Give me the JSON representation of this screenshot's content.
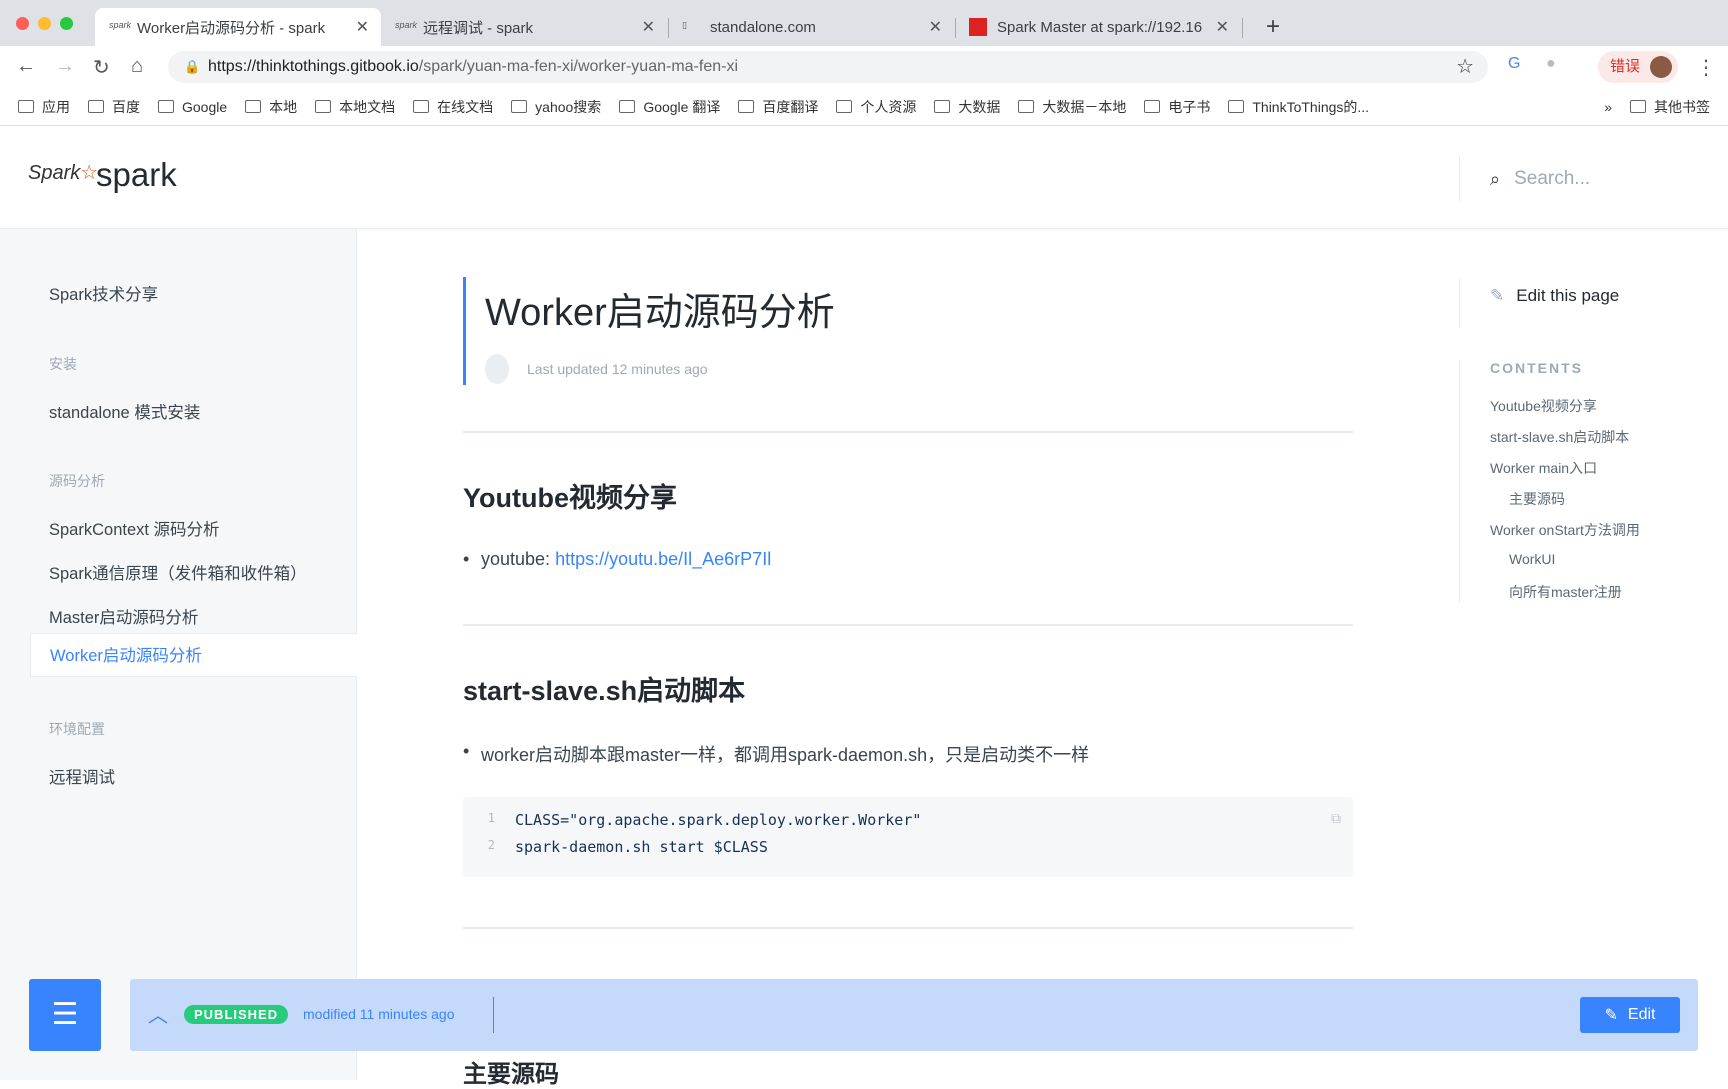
{
  "browser": {
    "tabs": [
      {
        "title": "Worker启动源码分析 - spark",
        "active": true
      },
      {
        "title": "远程调试 - spark"
      },
      {
        "title": "standalone.com"
      },
      {
        "title": "Spark Master at spark://192.16"
      }
    ],
    "url_domain": "https://thinktothings.gitbook.io",
    "url_path": "/spark/yuan-ma-fen-xi/worker-yuan-ma-fen-xi",
    "profile_status": "错误",
    "bookmarks": [
      "应用",
      "百度",
      "Google",
      "本地",
      "本地文档",
      "在线文档",
      "yahoo搜索",
      "Google 翻译",
      "百度翻译",
      "个人资源",
      "大数据",
      "大数据－本地",
      "电子书",
      "ThinkToThings的..."
    ],
    "other_bookmarks": "其他书签"
  },
  "header": {
    "brand": "spark",
    "logo_text": "Spark",
    "search_placeholder": "Search..."
  },
  "sidebar": {
    "items": [
      {
        "label": "Spark技术分享",
        "type": "item"
      },
      {
        "label": "安装",
        "type": "group"
      },
      {
        "label": "standalone 模式安装",
        "type": "item"
      },
      {
        "label": "源码分析",
        "type": "group"
      },
      {
        "label": "SparkContext 源码分析",
        "type": "item"
      },
      {
        "label": "Spark通信原理（发件箱和收件箱）",
        "type": "item"
      },
      {
        "label": "Master启动源码分析",
        "type": "item"
      },
      {
        "label": "Worker启动源码分析",
        "type": "item",
        "active": true
      },
      {
        "label": "环境配置",
        "type": "group"
      },
      {
        "label": "远程调试",
        "type": "item"
      }
    ]
  },
  "page": {
    "title": "Worker启动源码分析",
    "last_updated": "Last updated 12 minutes ago",
    "sections": [
      {
        "heading": "Youtube视频分享",
        "bullet_prefix": "youtube: ",
        "link": "https://youtu.be/Il_Ae6rP7Il"
      },
      {
        "heading": "start-slave.sh启动脚本",
        "bullet": "worker启动脚本跟master一样，都调用spark-daemon.sh，只是启动类不一样"
      }
    ],
    "code": [
      {
        "n": "1",
        "line": "CLASS=\"org.apache.spark.deploy.worker.Worker\""
      },
      {
        "n": "2",
        "line": "spark-daemon.sh start $CLASS"
      }
    ],
    "next_heading": "主要源码"
  },
  "toc": {
    "edit_label": "Edit this page",
    "heading": "CONTENTS",
    "items": [
      {
        "label": "Youtube视频分享"
      },
      {
        "label": "start-slave.sh启动脚本"
      },
      {
        "label": "Worker main入口"
      },
      {
        "label": "主要源码",
        "sub": true
      },
      {
        "label": "Worker onStart方法调用"
      },
      {
        "label": "WorkUI",
        "sub": true
      },
      {
        "label": "向所有master注册",
        "sub": true
      }
    ]
  },
  "bottom_bar": {
    "status": "PUBLISHED",
    "modified": "modified 11 minutes ago",
    "edit_label": "Edit"
  },
  "colors": {
    "accent": "#3884ff",
    "published": "#26cb7c",
    "bar": "#c5d9fb"
  }
}
